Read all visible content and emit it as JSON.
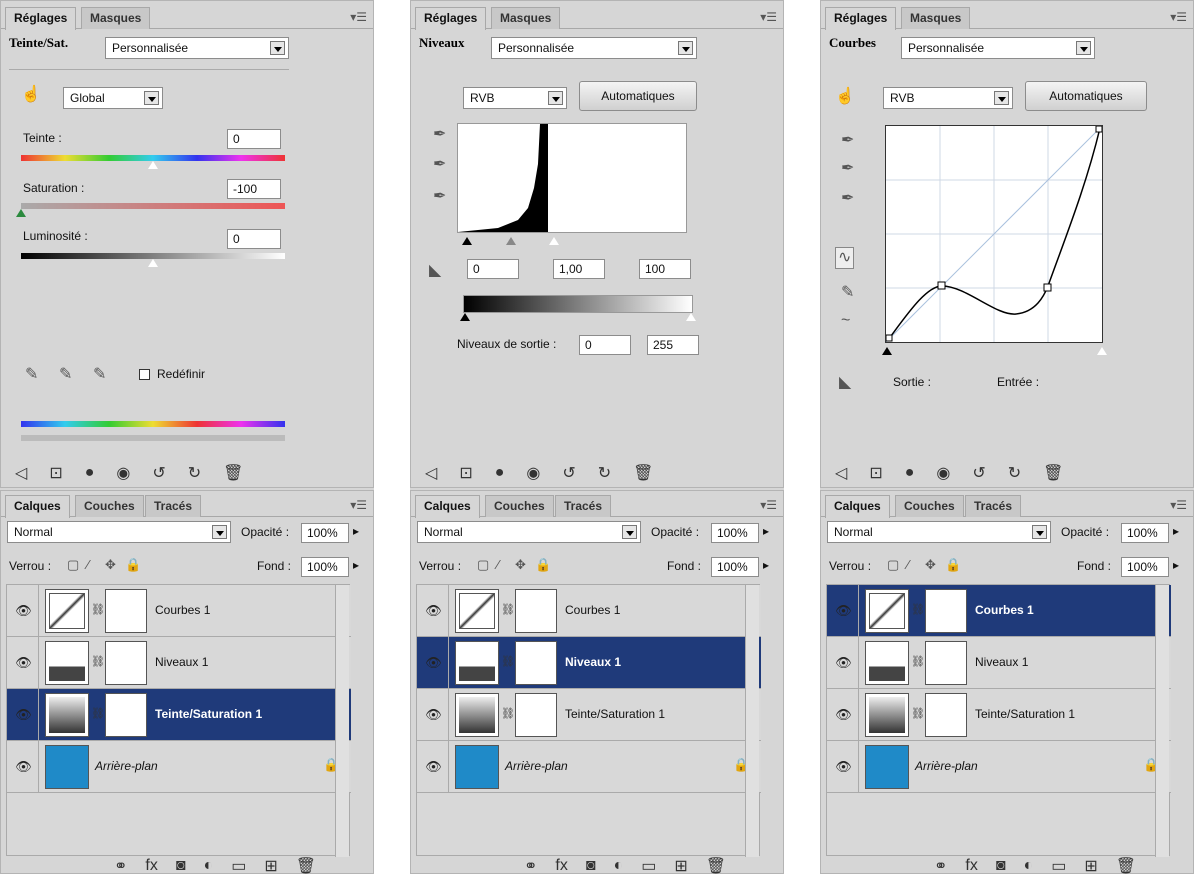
{
  "panels": [
    {
      "tabs": [
        "Réglages",
        "Masques"
      ],
      "title": "Teinte/Sat.",
      "preset": "Personnalisée",
      "channel": "Global",
      "teinte_label": "Teinte :",
      "teinte_value": "0",
      "saturation_label": "Saturation :",
      "saturation_value": "-100",
      "luminosite_label": "Luminosité :",
      "luminosite_value": "0",
      "redefinir_label": "Redéfinir"
    },
    {
      "tabs": [
        "Réglages",
        "Masques"
      ],
      "title": "Niveaux",
      "preset": "Personnalisée",
      "channel": "RVB",
      "auto_label": "Automatiques",
      "input_black": "0",
      "input_gamma": "1,00",
      "input_white": "100",
      "sortie_label": "Niveaux de sortie :",
      "sortie_black": "0",
      "sortie_white": "255"
    },
    {
      "tabs": [
        "Réglages",
        "Masques"
      ],
      "title": "Courbes",
      "preset": "Personnalisée",
      "channel": "RVB",
      "auto_label": "Automatiques",
      "sortie_label": "Sortie :",
      "entree_label": "Entrée :"
    }
  ],
  "layers_panels": [
    {
      "tabs": [
        "Calques",
        "Couches",
        "Tracés"
      ],
      "blend": "Normal",
      "opacity_label": "Opacité :",
      "opacity": "100%",
      "lock_label": "Verrou :",
      "fill_label": "Fond :",
      "fill": "100%",
      "selected": 2
    },
    {
      "tabs": [
        "Calques",
        "Couches",
        "Tracés"
      ],
      "blend": "Normal",
      "opacity_label": "Opacité :",
      "opacity": "100%",
      "lock_label": "Verrou :",
      "fill_label": "Fond :",
      "fill": "100%",
      "selected": 1
    },
    {
      "tabs": [
        "Calques",
        "Couches",
        "Tracés"
      ],
      "blend": "Normal",
      "opacity_label": "Opacité :",
      "opacity": "100%",
      "lock_label": "Verrou :",
      "fill_label": "Fond :",
      "fill": "100%",
      "selected": 0
    }
  ],
  "layers": [
    "Courbes 1",
    "Niveaux 1",
    "Teinte/Saturation 1",
    "Arrière-plan"
  ],
  "colors": {
    "selection": "#1f3a7a",
    "panel": "#d6d6d6",
    "background_layer": "#1f8ac8"
  }
}
